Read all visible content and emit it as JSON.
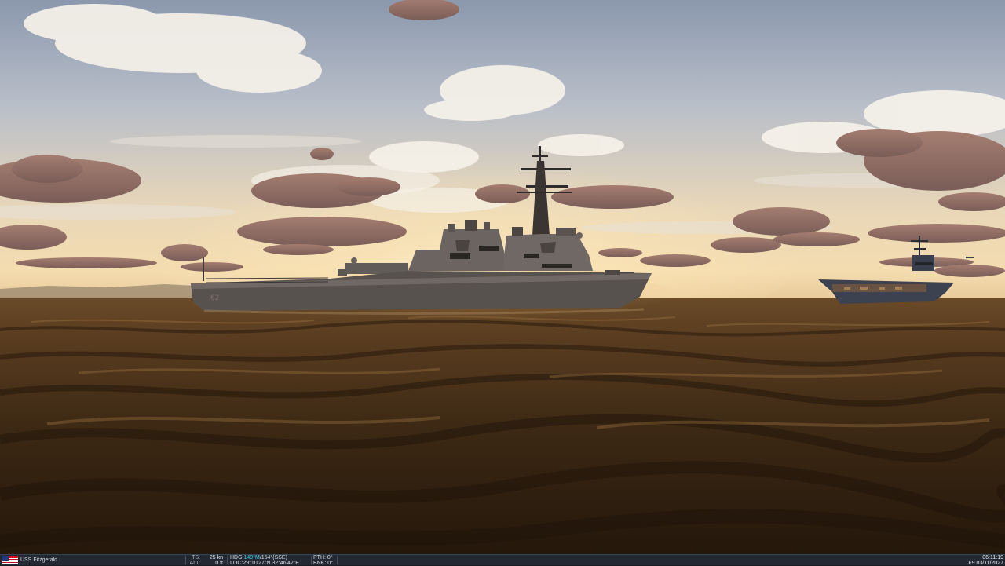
{
  "unit": {
    "name": "USS Fitzgerald",
    "flag": "us-flag-icon"
  },
  "telemetry": {
    "ts_label": "TS:",
    "ts_value": "25 kn",
    "alt_label": "ALT:",
    "alt_value": "0 ft",
    "hdg_label": "HDG:",
    "hdg_mag": "149°M",
    "hdg_true": "/154°(SSE)",
    "loc_label": "LOC:",
    "loc_value": "29°10'27\"N 32°46'42\"E",
    "pth_label": "PTH:",
    "pth_value": "0°",
    "bnk_label": "BNK:",
    "bnk_value": "0°"
  },
  "clock": {
    "time": "06:11:19",
    "date": "F9 03/11/2027"
  },
  "colors": {
    "accent": "#3fd0e8",
    "bar": "#232833"
  }
}
